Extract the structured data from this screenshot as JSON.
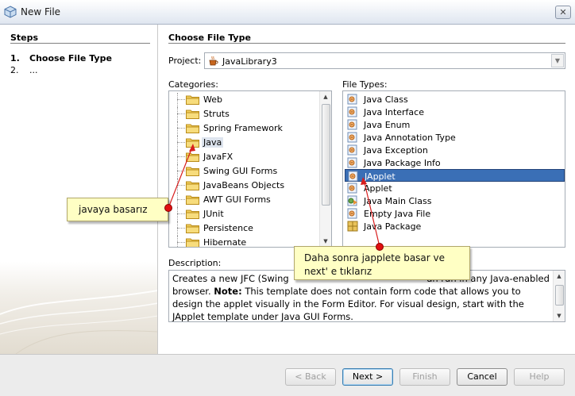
{
  "window": {
    "title": "New File",
    "close_symbol": "✕"
  },
  "steps": {
    "heading": "Steps",
    "items": [
      {
        "num": "1.",
        "label": "Choose File Type"
      },
      {
        "num": "2.",
        "label": "..."
      }
    ]
  },
  "main": {
    "heading": "Choose File Type",
    "project_label": "Project:",
    "project_value": "JavaLibrary3",
    "categories_label": "Categories:",
    "file_types_label": "File Types:",
    "categories": [
      "Web",
      "Struts",
      "Spring Framework",
      "Java",
      "JavaFX",
      "Swing GUI Forms",
      "JavaBeans Objects",
      "AWT GUI Forms",
      "JUnit",
      "Persistence",
      "Hibernate"
    ],
    "selected_category": "Java",
    "file_types": [
      "Java Class",
      "Java Interface",
      "Java Enum",
      "Java Annotation Type",
      "Java Exception",
      "Java Package Info",
      "JApplet",
      "Applet",
      "Java Main Class",
      "Empty Java File",
      "Java Package"
    ],
    "selected_file_type": "JApplet",
    "description_label": "Description:",
    "description": {
      "p1": "Creates a new JFC (Swing",
      "p2": "an run in any Java-enabled browser. ",
      "note_label": "Note:",
      "p3": " This template does not contain form code that allows you to design the applet visually in the Form Editor. For visual design, start with the JApplet template under Java GUI Forms."
    }
  },
  "buttons": {
    "back": "< Back",
    "next": "Next >",
    "finish": "Finish",
    "cancel": "Cancel",
    "help": "Help"
  },
  "annotations": {
    "callout_categories": "javaya basarız",
    "callout_file_types": "Daha sonra japplete basar ve next' e tıklarız"
  },
  "colors": {
    "selection": "#3a6fb6",
    "callout_bg": "#ffffc4",
    "arrow": "#d81e1e"
  }
}
